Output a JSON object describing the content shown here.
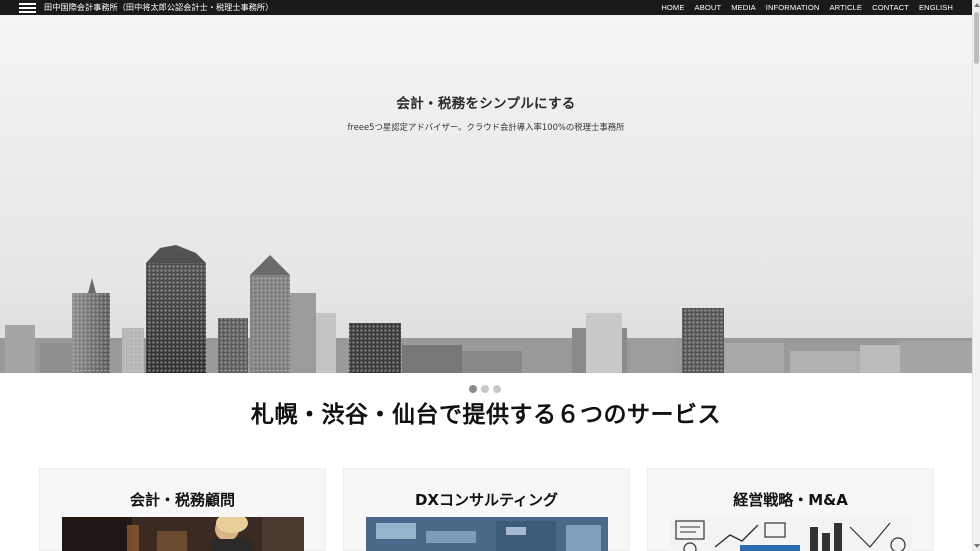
{
  "header": {
    "site_title": "田中国際会計事務所（田中将太郎公認会計士・税理士事務所）",
    "nav": [
      "HOME",
      "ABOUT",
      "MEDIA",
      "INFORMATION",
      "ARTICLE",
      "CONTACT",
      "ENGLISH"
    ]
  },
  "hero": {
    "title": "会計・税務をシンプルにする",
    "subtitle": "freee5つ星認定アドバイザー。クラウド会計導入率100%の税理士事務所",
    "slides_total": 3,
    "active_slide": 1
  },
  "services": {
    "title": "札幌・渋谷・仙台で提供する６つのサービス",
    "cards": [
      {
        "title": "会計・税務顧問"
      },
      {
        "title": "DXコンサルティング"
      },
      {
        "title": "経営戦略・M&A"
      }
    ]
  }
}
